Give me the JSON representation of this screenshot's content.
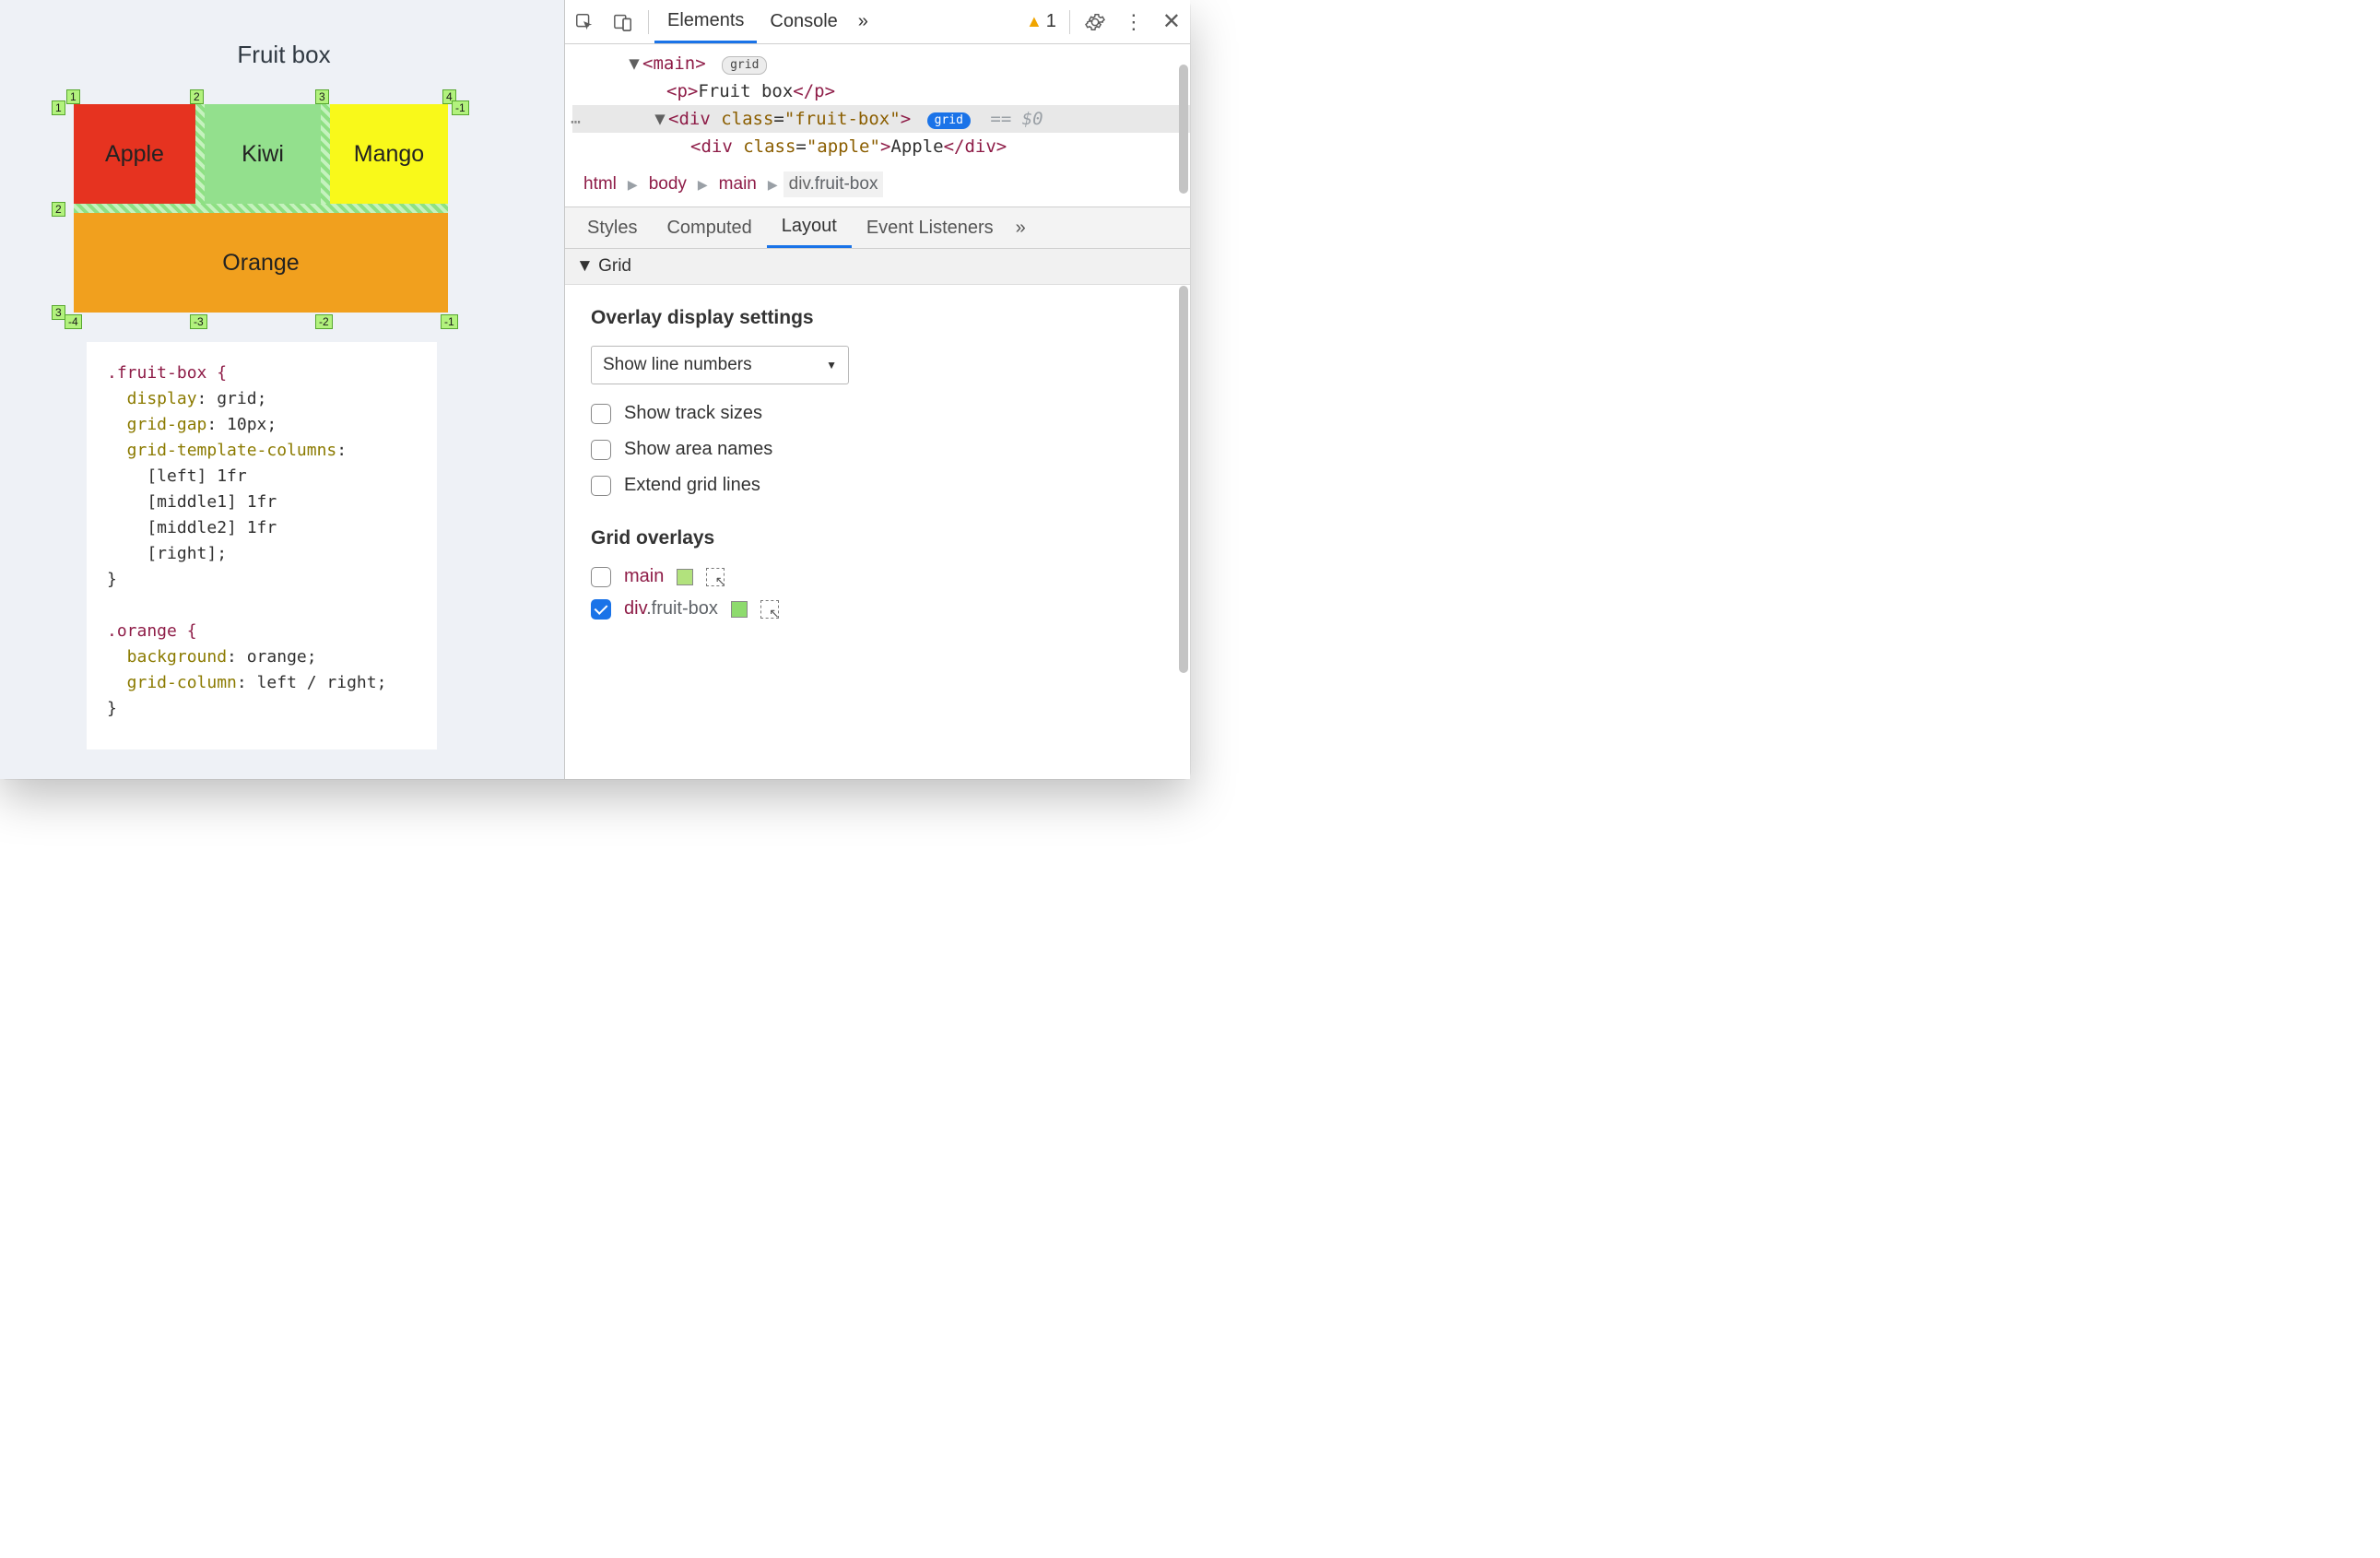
{
  "page": {
    "title": "Fruit box",
    "grid": {
      "cells": {
        "apple": "Apple",
        "kiwi": "Kiwi",
        "mango": "Mango",
        "orange": "Orange"
      },
      "line_numbers": {
        "top": [
          "1",
          "2",
          "3",
          "4"
        ],
        "bottom": [
          "-4",
          "-3",
          "-2",
          "-1"
        ],
        "left": [
          "1",
          "2",
          "3"
        ],
        "right": [
          "-1"
        ]
      }
    },
    "css": {
      "fruit_box_selector": ".fruit-box {",
      "fb_display": "  display: grid;",
      "fb_gap": "  grid-gap: 10px;",
      "fb_cols": "  grid-template-columns:",
      "fb_c1": "    [left] 1fr",
      "fb_c2": "    [middle1] 1fr",
      "fb_c3": "    [middle2] 1fr",
      "fb_c4": "    [right];",
      "close1": "}",
      "orange_selector": ".orange {",
      "or_bg": "  background: orange;",
      "or_col": "  grid-column: left / right;",
      "close2": "}"
    }
  },
  "devtools": {
    "tabs": {
      "elements": "Elements",
      "console": "Console",
      "more": "»"
    },
    "warning_count": "1",
    "dom": {
      "main_open": "<main>",
      "main_badge": "grid",
      "p_text": "Fruit box",
      "p_open": "<p>",
      "p_close": "</p>",
      "div_open": "<div ",
      "div_class_attr": "class",
      "div_class_val": "\"fruit-box\"",
      "div_close_gt": ">",
      "div_badge": "grid",
      "eq0": "== $0",
      "apple_open": "<div ",
      "apple_class_val": "\"apple\"",
      "apple_text": "Apple",
      "apple_close": "</div>"
    },
    "crumbs": {
      "html": "html",
      "body": "body",
      "main": "main",
      "div": "div",
      "divclass": ".fruit-box"
    },
    "subtabs": {
      "styles": "Styles",
      "computed": "Computed",
      "layout": "Layout",
      "evt": "Event Listeners",
      "more": "»"
    },
    "grid_section": "Grid",
    "overlay_settings_title": "Overlay display settings",
    "line_select": "Show line numbers",
    "checks": {
      "tracks": "Show track sizes",
      "areas": "Show area names",
      "extend": "Extend grid lines"
    },
    "grid_overlays_title": "Grid overlays",
    "overlays": [
      {
        "checked": false,
        "name": "main",
        "cls": "",
        "color": "#b2e27d"
      },
      {
        "checked": true,
        "name": "div",
        "cls": ".fruit-box",
        "color": "#8edb6e"
      }
    ]
  }
}
